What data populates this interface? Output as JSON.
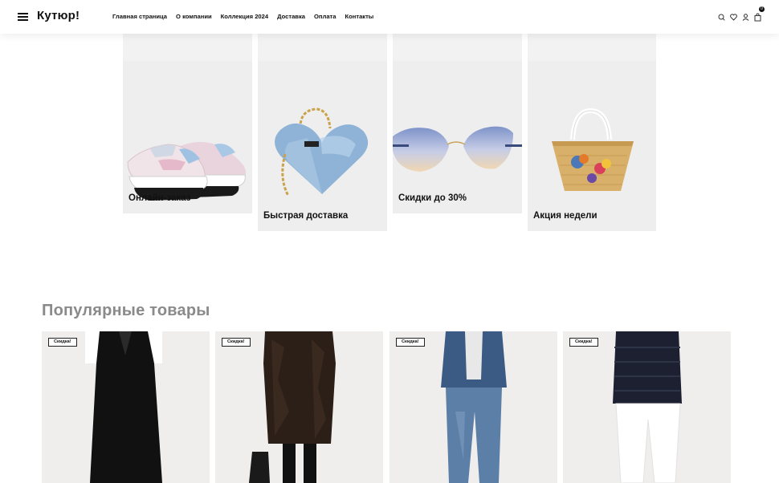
{
  "header": {
    "logo": "Кутюр!",
    "nav": [
      "Главная страница",
      "О компании",
      "Коллекция 2024",
      "Доставка",
      "Оплата",
      "Контакты"
    ],
    "cart_count": "0",
    "icons": [
      "search-icon",
      "heart-icon",
      "user-icon",
      "bag-icon"
    ]
  },
  "features": [
    {
      "label": "Онлайн-заказ",
      "icon": "sneakers-image"
    },
    {
      "label": "Быстрая доставка",
      "icon": "heart-bag-image"
    },
    {
      "label": "Скидки до 30%",
      "icon": "sunglasses-image"
    },
    {
      "label": "Акция недели",
      "icon": "basket-bag-image"
    }
  ],
  "popular": {
    "title": "Популярные товары",
    "products": [
      {
        "tag": "Скидка!"
      },
      {
        "tag": "Скидка!"
      },
      {
        "tag": "Скидка!"
      },
      {
        "tag": "Скидка!"
      }
    ]
  }
}
